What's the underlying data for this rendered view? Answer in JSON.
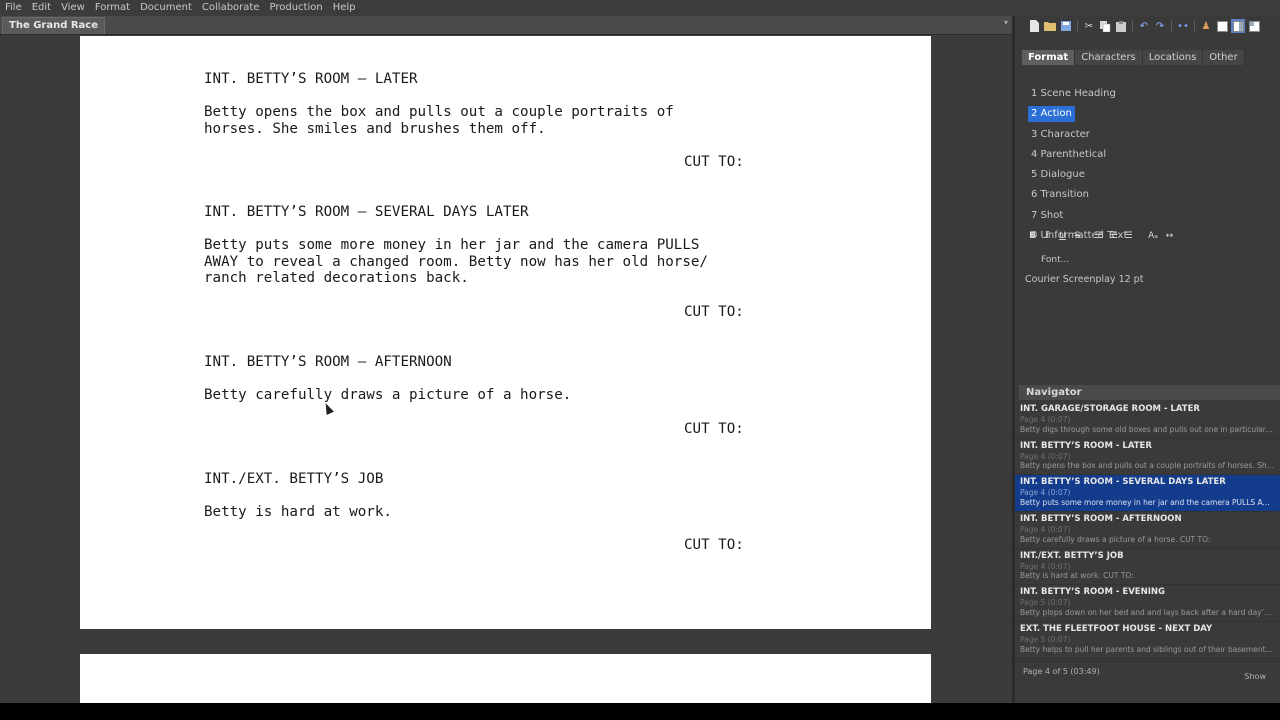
{
  "menu": [
    "File",
    "Edit",
    "View",
    "Format",
    "Document",
    "Collaborate",
    "Production",
    "Help"
  ],
  "document": {
    "tab_title": "The Grand Race",
    "tab_menu_icon": "chevron-down-icon"
  },
  "script": {
    "scene1_heading": "INT. BETTY’S ROOM – LATER",
    "scene1_action": "Betty opens the box and pulls out a couple portraits of\nhorses. She smiles and brushes them off.",
    "scene1_transition": "CUT TO:",
    "scene2_heading": "INT. BETTY’S ROOM – SEVERAL DAYS LATER",
    "scene2_action": "Betty puts some more money in her jar and the camera PULLS\nAWAY to reveal a changed room. Betty now has her old horse/\nranch related decorations back.",
    "scene2_transition": "CUT TO:",
    "scene3_heading": "INT. BETTY’S ROOM – AFTERNOON",
    "scene3_action": "Betty carefully draws a picture of a horse.",
    "scene3_transition": "CUT TO:",
    "scene4_heading": "INT./EXT. BETTY’S JOB",
    "scene4_action": "Betty is hard at work.",
    "scene4_transition": "CUT TO:"
  },
  "toolbar_icons": [
    "new-document-icon",
    "open-folder-icon",
    "save-icon",
    "cut-icon",
    "copy-icon",
    "paste-icon",
    "undo-icon",
    "redo-icon",
    "collaborate-icon",
    "characters-icon",
    "layout-single-icon",
    "layout-split-icon",
    "layout-full-icon"
  ],
  "format_tabs": [
    {
      "label": "Format",
      "active": true
    },
    {
      "label": "Characters",
      "active": false
    },
    {
      "label": "Locations",
      "active": false
    },
    {
      "label": "Other",
      "active": false
    }
  ],
  "format_items": [
    {
      "label": "1 Scene Heading",
      "active": false
    },
    {
      "label": "2 Action",
      "active": true
    },
    {
      "label": "3 Character",
      "active": false
    },
    {
      "label": "4 Parenthetical",
      "active": false
    },
    {
      "label": "5 Dialogue",
      "active": false
    },
    {
      "label": "6 Transition",
      "active": false
    },
    {
      "label": "7 Shot",
      "active": false
    },
    {
      "label": "0 Unformatted Text",
      "active": false
    }
  ],
  "style_buttons": {
    "bold": "B",
    "italic": "I",
    "underline": "U",
    "strike": "S",
    "align_left": "☰",
    "align_center": "☰",
    "align_right": "☰",
    "case": "Aₐ",
    "spacing": "↔"
  },
  "font": {
    "button_label": "Font...",
    "current_font": "Courier Screenplay 12 pt"
  },
  "navigator": {
    "title": "Navigator",
    "items": [
      {
        "heading": "INT. GARAGE/STORAGE ROOM - LATER",
        "page": "Page 4 (0:07)",
        "desc": "Betty digs through some old boxes and pulls out one in particular. C...",
        "selected": false
      },
      {
        "heading": "INT. BETTY’S ROOM - LATER",
        "page": "Page 4 (0:07)",
        "desc": "Betty opens the box and pulls out a couple portraits of horses. She s...",
        "selected": false
      },
      {
        "heading": "INT. BETTY’S ROOM - SEVERAL DAYS LATER",
        "page": "Page 4 (0:07)",
        "desc": "Betty puts some more money in her jar and the camera PULLS AWAY t...",
        "selected": true
      },
      {
        "heading": "INT. BETTY’S ROOM - AFTERNOON",
        "page": "Page 4 (0:07)",
        "desc": "Betty carefully draws a picture of a horse.  CUT TO:",
        "selected": false
      },
      {
        "heading": "INT./EXT. BETTY’S JOB",
        "page": "Page 4 (0:07)",
        "desc": "Betty is hard at work.  CUT TO:",
        "selected": false
      },
      {
        "heading": "INT. BETTY’S ROOM - EVENING",
        "page": "Page 5 (0:07)",
        "desc": "Betty plops down on her bed and and lays back after a hard day’s wo...",
        "selected": false
      },
      {
        "heading": "EXT. THE FLEETFOOT HOUSE - NEXT DAY",
        "page": "Page 5 (0:07)",
        "desc": "Betty helps to pull her parents and siblings out of their basement/sto...",
        "selected": false
      }
    ],
    "page_info": "Page 4 of 5 (03:49)",
    "show_label": "Show"
  }
}
